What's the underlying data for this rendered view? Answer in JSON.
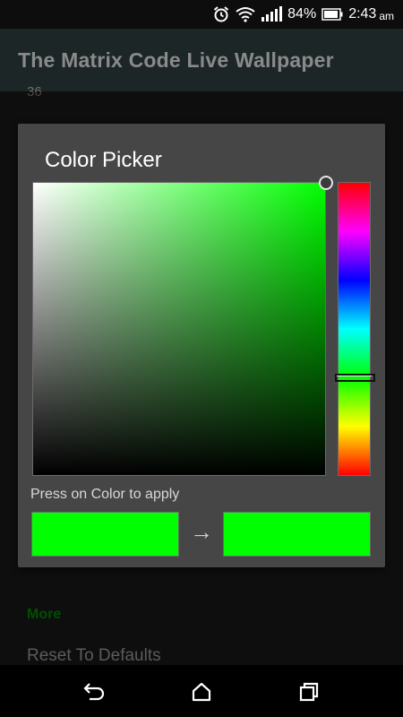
{
  "statusbar": {
    "battery_percent": "84%",
    "time": "2:43",
    "ampm": "am",
    "icons": [
      "alarm-icon",
      "wifi-icon",
      "signal-icon",
      "battery-icon"
    ]
  },
  "appbar": {
    "title": "The Matrix Code Live Wallpaper"
  },
  "background": {
    "partial_value": "36",
    "more_label": "More",
    "reset_label": "Reset To Defaults"
  },
  "dialog": {
    "title": "Color Picker",
    "hint": "Press on Color to apply",
    "arrow": "→",
    "old_color": "#00ff00",
    "new_color": "#00ff00",
    "hue_color": "#00ff00"
  },
  "navbar": {
    "icons": [
      "back-icon",
      "home-icon",
      "recents-icon"
    ]
  }
}
